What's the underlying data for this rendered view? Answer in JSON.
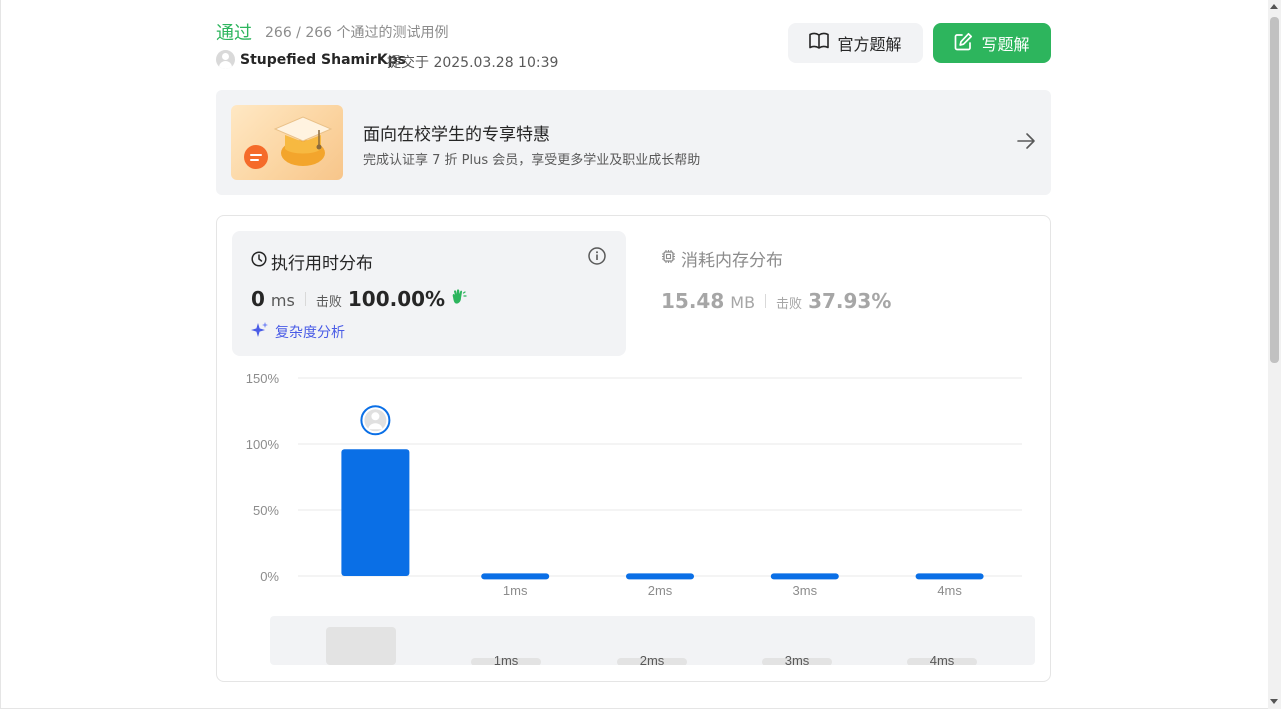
{
  "header": {
    "status": "通过",
    "cases": "266 / 266 个通过的测试用例",
    "username": "Stupefied ShamirKps",
    "submitted_at": "提交于 2025.03.28 10:39",
    "official_solution_label": "官方题解",
    "write_solution_label": "写题解"
  },
  "promo": {
    "title": "面向在校学生的专享特惠",
    "subtitle": "完成认证享 7 折 Plus 会员，享受更多学业及职业成长帮助"
  },
  "runtime": {
    "title": "执行用时分布",
    "value": "0",
    "unit": "ms",
    "beat_label": "击败",
    "beat_value": "100.00%",
    "complexity_label": "复杂度分析"
  },
  "memory": {
    "title": "消耗内存分布",
    "value": "15.48",
    "unit": "MB",
    "beat_label": "击败",
    "beat_value": "37.93%"
  },
  "colors": {
    "accent_green": "#2db55d",
    "bar_blue": "#0a6fe6",
    "panel_gray": "#f2f3f5"
  },
  "chart_data": {
    "type": "bar",
    "categories": [
      "",
      "1ms",
      "2ms",
      "3ms",
      "4ms"
    ],
    "values": [
      96,
      2,
      2,
      2,
      2
    ],
    "ytick_labels": [
      "0%",
      "50%",
      "100%",
      "150%"
    ],
    "ylim": [
      0,
      150
    ],
    "grid": true,
    "highlight_index": 0
  },
  "minimap": {
    "labels": [
      "1ms",
      "2ms",
      "3ms",
      "4ms"
    ]
  }
}
